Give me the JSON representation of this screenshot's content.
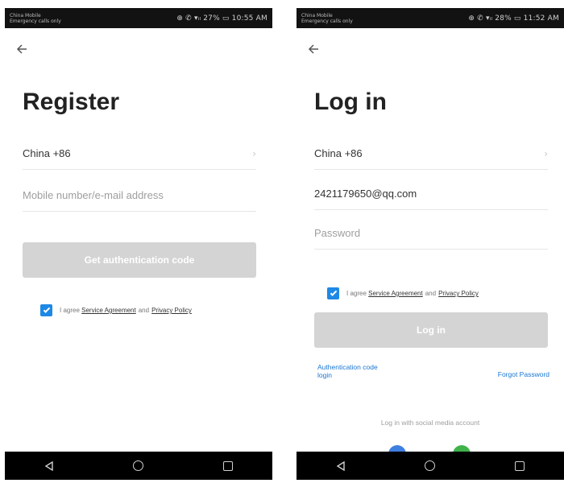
{
  "colors": {
    "accent_blue": "#1976d2",
    "checkbox_blue": "#1e88e5",
    "disabled_button": "#d4d4d4",
    "statusbar": "#121212",
    "navbar": "#000000"
  },
  "register": {
    "status_bar": {
      "carrier_line1": "China Mobile",
      "carrier_line2": "Emergency calls only",
      "right": "⊕ ✆ ▾ᵢₗ 27% ▭ 10:55 AM"
    },
    "back_icon": "back-arrow-icon",
    "title": "Register",
    "country_field": {
      "value": "China +86",
      "icon": "chevron-right-icon"
    },
    "account_field": {
      "placeholder": "Mobile number/e-mail address"
    },
    "submit_label": "Get authentication code",
    "agreement": {
      "checked": true,
      "prefix": "I agree",
      "service_link": "Service Agreement",
      "conjunction": "and",
      "privacy_link": "Privacy Policy"
    }
  },
  "login": {
    "status_bar": {
      "carrier_line1": "China Mobile",
      "carrier_line2": "Emergency calls only",
      "right": "⊕ ✆ ▾ᵢₗ 28% ▭ 11:52 AM"
    },
    "back_icon": "back-arrow-icon",
    "title": "Log in",
    "country_field": {
      "value": "China +86",
      "icon": "chevron-right-icon"
    },
    "account_field": {
      "value": "2421179650@qq.com"
    },
    "password_field": {
      "placeholder": "Password"
    },
    "agreement": {
      "checked": true,
      "prefix": "I agree",
      "service_link": "Service Agreement",
      "conjunction": "and",
      "privacy_link": "Privacy Policy"
    },
    "submit_label": "Log in",
    "auth_code_link_line1": "Authentication code",
    "auth_code_link_line2": "login",
    "forgot_password_link": "Forgot Password",
    "social_text": "Log in with social media account",
    "social_icons": [
      "social-login-icon-blue",
      "social-login-icon-green"
    ]
  },
  "navbar": {
    "buttons": [
      "back-triangle-icon",
      "home-circle-icon",
      "recents-square-icon"
    ]
  }
}
